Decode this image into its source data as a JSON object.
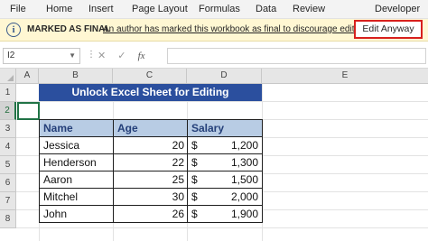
{
  "ribbon": {
    "tabs": [
      "File",
      "Home",
      "Insert",
      "Page Layout",
      "Formulas",
      "Data",
      "Review",
      "Developer"
    ]
  },
  "message_bar": {
    "title": "MARKED AS FINAL",
    "text": "An author has marked this workbook as final to discourage editing.",
    "button_label": "Edit Anyway",
    "icon": "info-icon",
    "highlight_color": "#d8201d"
  },
  "formula_bar": {
    "name_box": "I2",
    "cancel_symbol": "✕",
    "enter_symbol": "✓",
    "fx_label": "fx",
    "formula": ""
  },
  "sheet": {
    "columns": [
      "A",
      "B",
      "C",
      "D",
      "E"
    ],
    "rows": [
      "1",
      "2",
      "3",
      "4",
      "5",
      "6",
      "7",
      "8"
    ],
    "selected_row": "2",
    "title": "Unlock Excel Sheet for Editing",
    "title_bg": "#2b4f9e",
    "header_bg": "#b8cce4",
    "table": {
      "headers": [
        "Name",
        "Age",
        "Salary"
      ],
      "rows": [
        {
          "name": "Jessica",
          "age": "20",
          "currency": "$",
          "salary": "1,200"
        },
        {
          "name": "Henderson",
          "age": "22",
          "currency": "$",
          "salary": "1,300"
        },
        {
          "name": "Aaron",
          "age": "25",
          "currency": "$",
          "salary": "1,500"
        },
        {
          "name": "Mitchel",
          "age": "30",
          "currency": "$",
          "salary": "2,000"
        },
        {
          "name": "John",
          "age": "26",
          "currency": "$",
          "salary": "1,900"
        }
      ]
    }
  }
}
